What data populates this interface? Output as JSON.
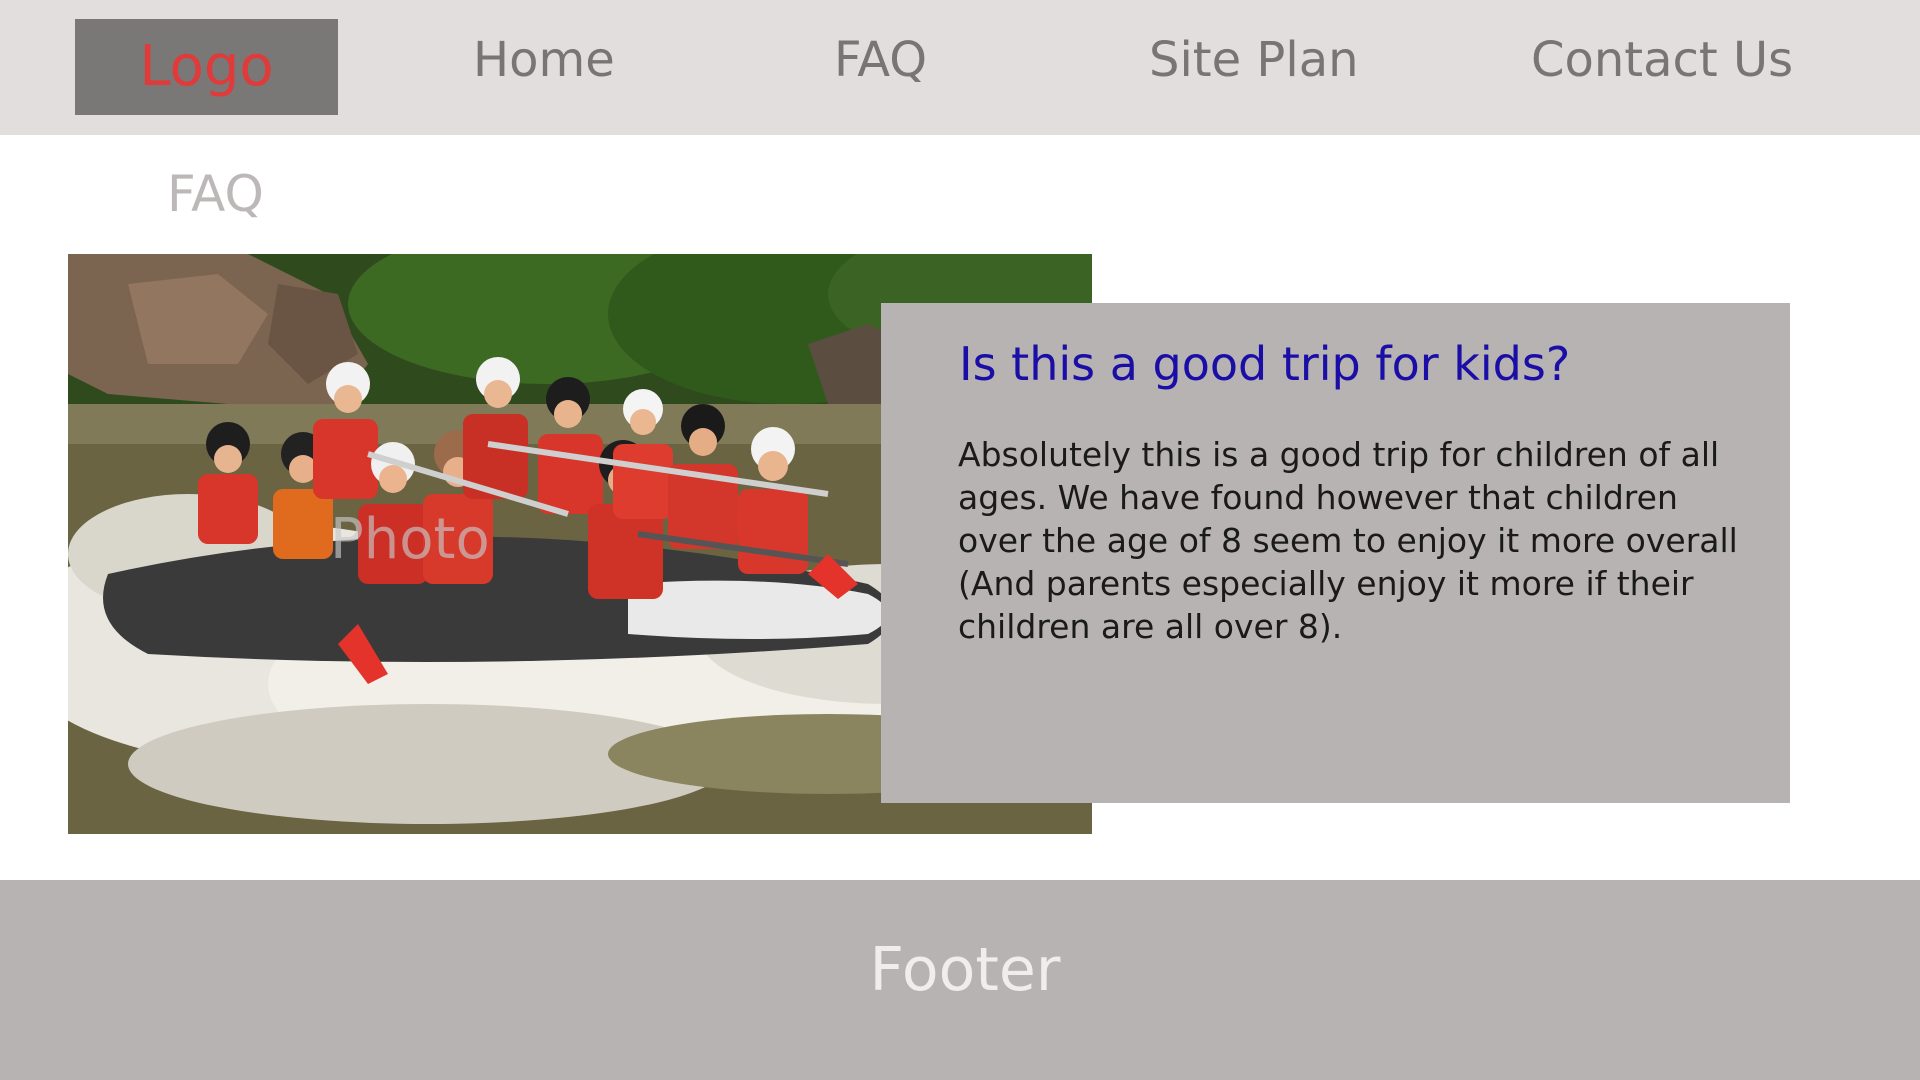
{
  "header": {
    "logo": "Logo",
    "nav": {
      "home": "Home",
      "faq": "FAQ",
      "site_plan": "Site Plan",
      "contact": "Contact Us"
    }
  },
  "page": {
    "title": "FAQ"
  },
  "photo": {
    "label": "Photo",
    "description_icon": "rafting-photo"
  },
  "faq": {
    "question": "Is this a good trip for kids?",
    "answer": "Absolutely this is a good trip for children of all ages. We have found however that children over the age of 8 seem to enjoy it more overall (And parents especially enjoy it more if their children are all over 8)."
  },
  "footer": {
    "text": "Footer"
  },
  "colors": {
    "header_bg": "#e1dedd",
    "logo_bg": "#7a7777",
    "logo_text": "#e03a3a",
    "nav_text": "#777575",
    "page_title": "#bdb8b8",
    "card_bg": "#b8b3b3",
    "question_text": "#1a0ea6",
    "footer_bg": "#b8b3b3",
    "footer_text": "#f0eded"
  }
}
